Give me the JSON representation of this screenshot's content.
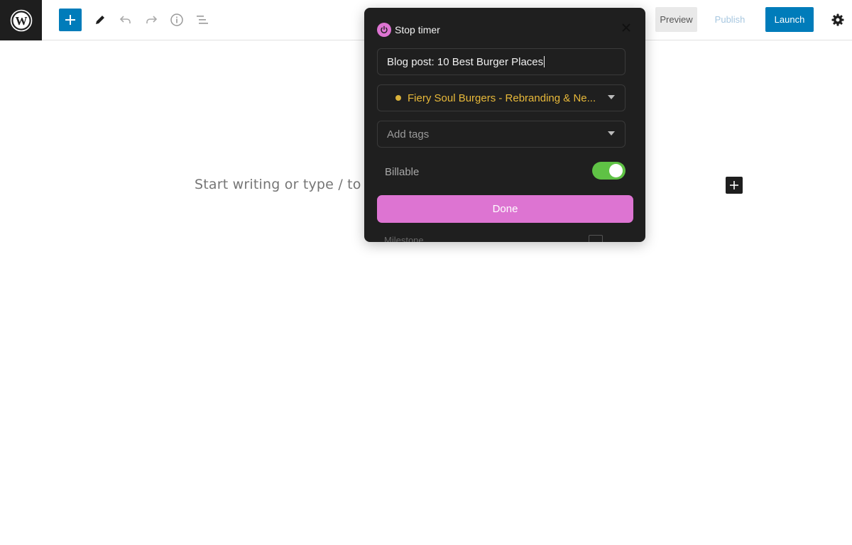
{
  "toolbar": {
    "preview_label": "Preview",
    "publish_label": "Publish",
    "launch_label": "Launch"
  },
  "editor": {
    "placeholder": "Start writing or type / to c"
  },
  "timer_popup": {
    "title": "Stop timer",
    "description": "Blog post: 10 Best Burger Places",
    "project": "Fiery Soul Burgers - Rebranding & Ne...",
    "tags_placeholder": "Add tags",
    "billable_label": "Billable",
    "billable_on": true,
    "done_label": "Done",
    "hidden_row_text": "Milestone"
  },
  "colors": {
    "wp_blue": "#007cba",
    "accent_pink": "#dd74d2",
    "project_color": "#e8b93a",
    "toggle_green": "#5fc245"
  },
  "icons": [
    "wordpress-logo-icon",
    "plus-icon",
    "pencil-icon",
    "undo-icon",
    "redo-icon",
    "info-icon",
    "list-view-icon",
    "gear-icon",
    "power-icon",
    "close-icon",
    "dropdown-arrow-icon"
  ]
}
